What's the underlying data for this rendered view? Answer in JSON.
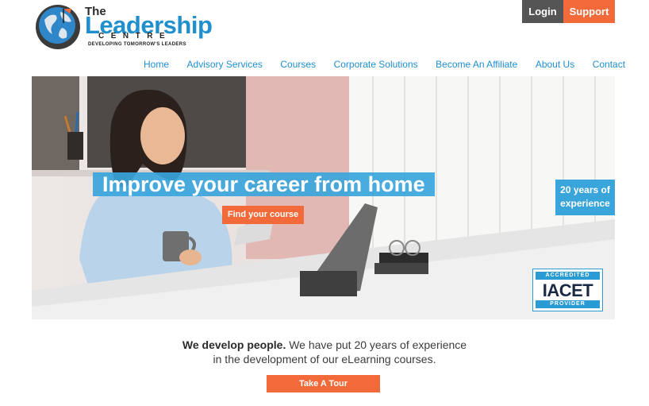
{
  "logo": {
    "the": "The",
    "leadership": "Leadership",
    "centre": "CENTRE",
    "tagline": "DEVELOPING TOMORROW'S LEADERS"
  },
  "header": {
    "login_label": "Login",
    "support_label": "Support"
  },
  "nav": {
    "items": [
      "Home",
      "Advisory Services",
      "Courses",
      "Corporate Solutions",
      "Become An Affiliate",
      "About Us",
      "Contact"
    ]
  },
  "hero": {
    "headline": "Improve your career from home",
    "cta_label": "Find your course",
    "badge_line1": "20 years of",
    "badge_line2": "experience",
    "accreditation": {
      "top": "ACCREDITED",
      "name": "IACET",
      "bottom": "PROVIDER"
    }
  },
  "intro": {
    "bold": "We develop people.",
    "line1_rest": " We have put 20 years of experience",
    "line2": "in the development of our eLearning courses."
  },
  "tour_label": "Take A Tour",
  "colors": {
    "accent_orange": "#f26a3a",
    "brand_blue": "#3aa5db",
    "nav_blue": "#1f8fce",
    "login_gray": "#555555"
  }
}
